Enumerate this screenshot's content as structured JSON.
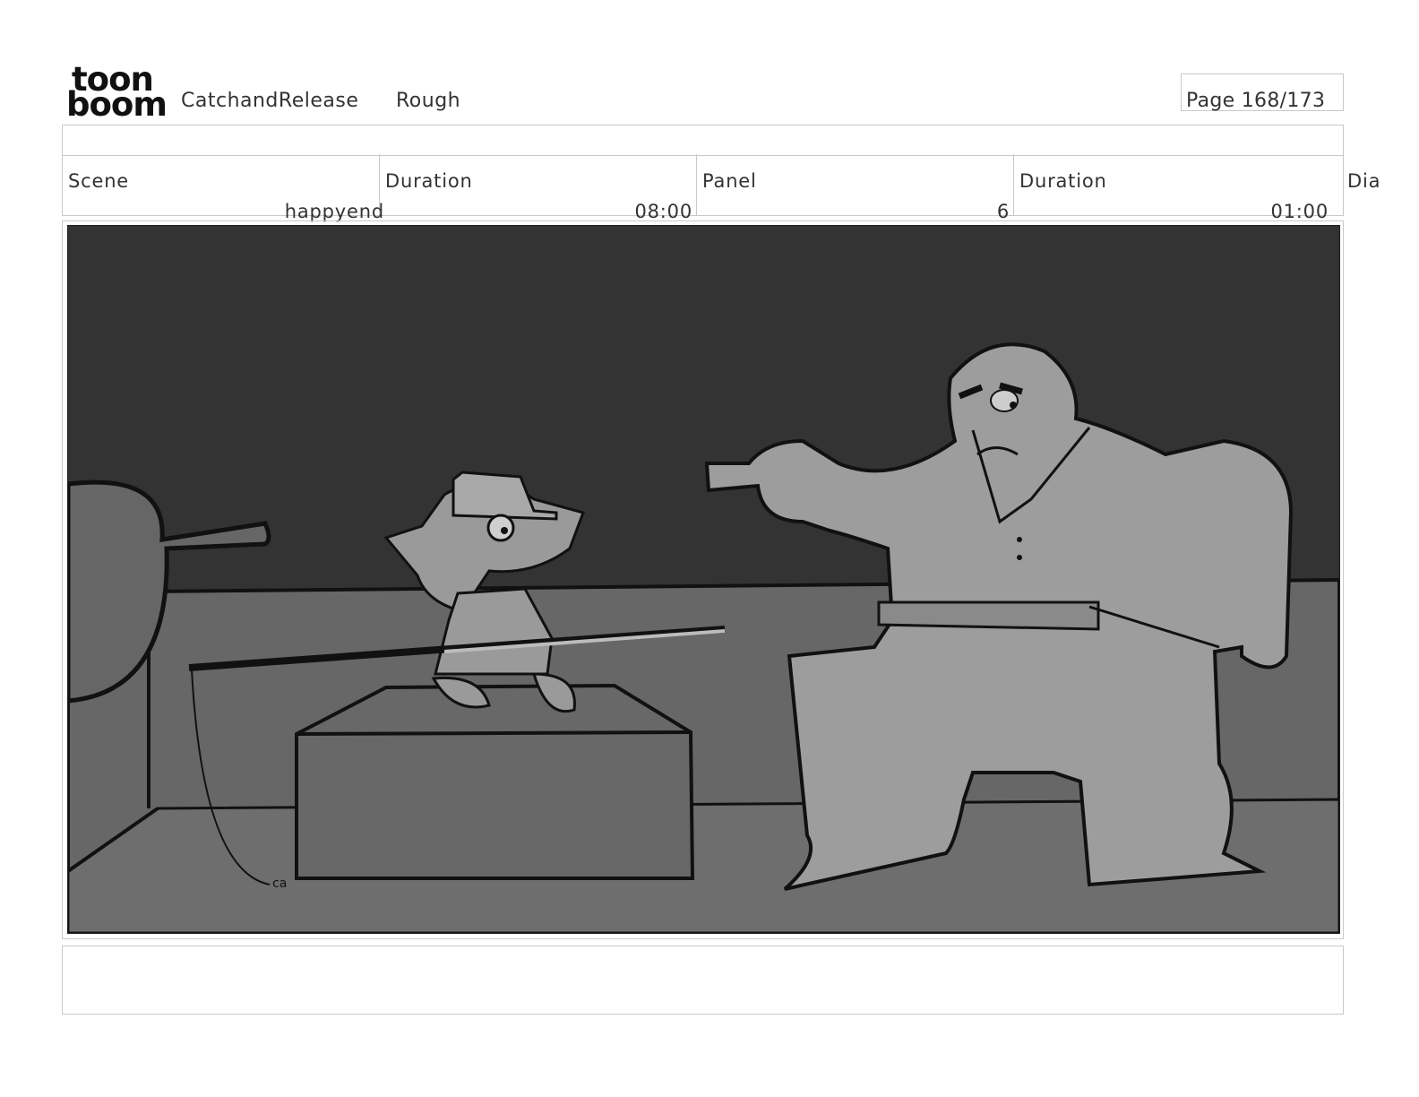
{
  "header": {
    "logo_line1": "toon",
    "logo_line2": "boom",
    "project": "CatchandRelease",
    "stage": "Rough",
    "page": "Page 168/173"
  },
  "info": {
    "scene_label": "Scene",
    "scene_value": "happyend",
    "duration_label": "Duration",
    "duration_value": "08:00",
    "panel_label": "Panel",
    "panel_value": "6",
    "panel_duration_label": "Duration",
    "panel_duration_value": "01:00",
    "dialogue_label": "Dia"
  },
  "panel": {
    "description_icon": "storyboard-drawing",
    "signature": "ca"
  },
  "colors": {
    "background_wall": "#333333",
    "floor": "#6a6a6a",
    "character_fill": "#9a9a9a",
    "border": "#c9c9c9"
  }
}
